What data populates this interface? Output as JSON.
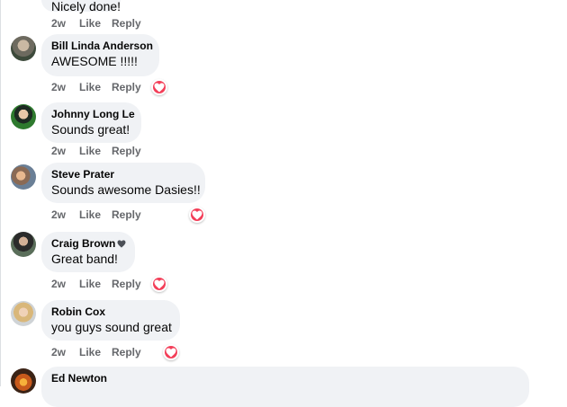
{
  "comments": [
    {
      "name": "",
      "text": "Nicely done!",
      "time": "2w",
      "like": "Like",
      "reply": "Reply",
      "reaction": ""
    },
    {
      "name": "Bill Linda Anderson",
      "text": "AWESOME !!!!!",
      "time": "2w",
      "like": "Like",
      "reply": "Reply",
      "reaction": "love-icon"
    },
    {
      "name": "Johnny Long Le",
      "text": "Sounds great!",
      "time": "2w",
      "like": "Like",
      "reply": "Reply",
      "reaction": ""
    },
    {
      "name": "Steve Prater",
      "text": "Sounds awesome Dasies!!",
      "time": "2w",
      "like": "Like",
      "reply": "Reply",
      "reaction": "love-icon"
    },
    {
      "name": "Craig Brown",
      "text": "Great band!",
      "time": "2w",
      "like": "Like",
      "reply": "Reply",
      "reaction": "love-icon",
      "badge": "heart-badge-icon"
    },
    {
      "name": "Robin Cox",
      "text": "you guys sound great",
      "time": "2w",
      "like": "Like",
      "reply": "Reply",
      "reaction": "love-icon"
    },
    {
      "name": "Ed Newton",
      "text": "",
      "time": "",
      "like": "",
      "reply": "",
      "reaction": ""
    }
  ],
  "colors": {
    "bubble": "#f0f2f5",
    "secondary_text": "#65676b",
    "love": "#f33e58"
  }
}
